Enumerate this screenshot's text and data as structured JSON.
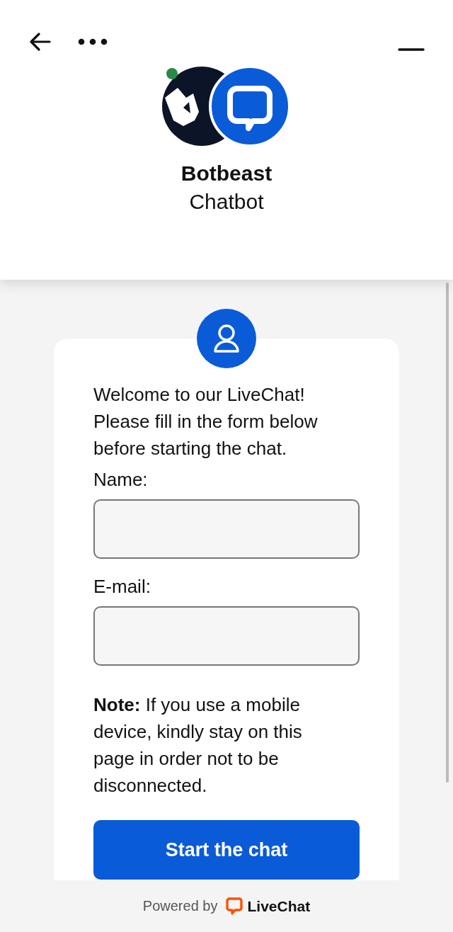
{
  "header": {
    "bot_name": "Botbeast",
    "bot_role": "Chatbot",
    "online": true
  },
  "form": {
    "intro": "Welcome to our LiveChat! Please fill in the form below before starting the chat.",
    "fields": [
      {
        "label": "Name:"
      },
      {
        "label": "E-mail:"
      }
    ],
    "note": "**Note:** If you use a mobile device, kindly stay on this page in order not to be disconnected.",
    "submit": "Start the chat"
  },
  "footer": {
    "powered_by": "Powered by",
    "brand": "LiveChat"
  }
}
